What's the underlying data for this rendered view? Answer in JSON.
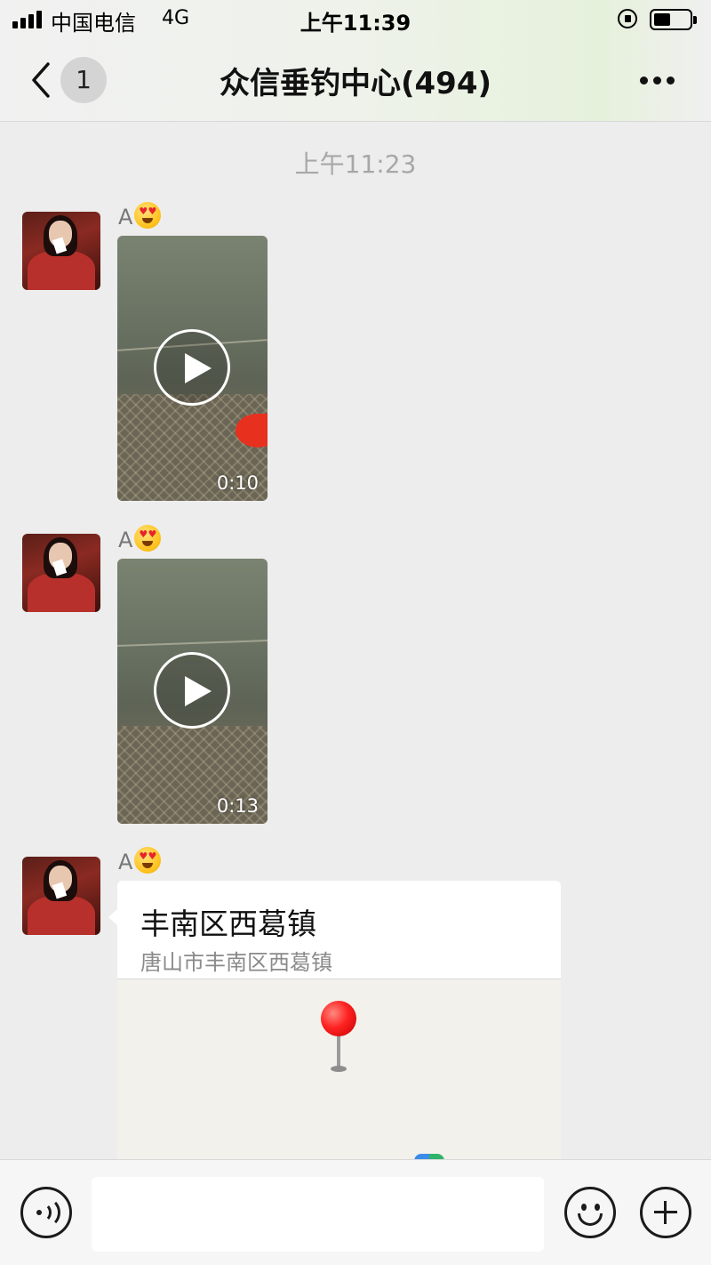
{
  "status_bar": {
    "carrier": "中国电信",
    "network": "4G",
    "time": "上午11:39",
    "icons": [
      "signal-icon",
      "orientation-lock-icon",
      "battery-icon"
    ]
  },
  "nav": {
    "back_icon": "chevron-left-icon",
    "unread_count": "1",
    "title": "众信垂钓中心(494)",
    "more_icon": "more-dots-icon"
  },
  "chat": {
    "timestamp": "上午11:23",
    "messages": [
      {
        "sender": "A",
        "sender_emoji": "heart-eyes-emoji",
        "type": "video",
        "duration": "0:10"
      },
      {
        "sender": "A",
        "sender_emoji": "heart-eyes-emoji",
        "type": "video",
        "duration": "0:13"
      },
      {
        "sender": "A",
        "sender_emoji": "heart-eyes-emoji",
        "type": "location",
        "location_name": "丰南区西葛镇",
        "location_address": "唐山市丰南区西葛镇"
      }
    ]
  },
  "input_bar": {
    "voice_icon": "voice-icon",
    "input_value": "",
    "emoji_icon": "emoji-icon",
    "add_icon": "plus-icon"
  },
  "colors": {
    "background": "#ededed",
    "pin": "#ff2222",
    "buoy": "#e8301e"
  }
}
